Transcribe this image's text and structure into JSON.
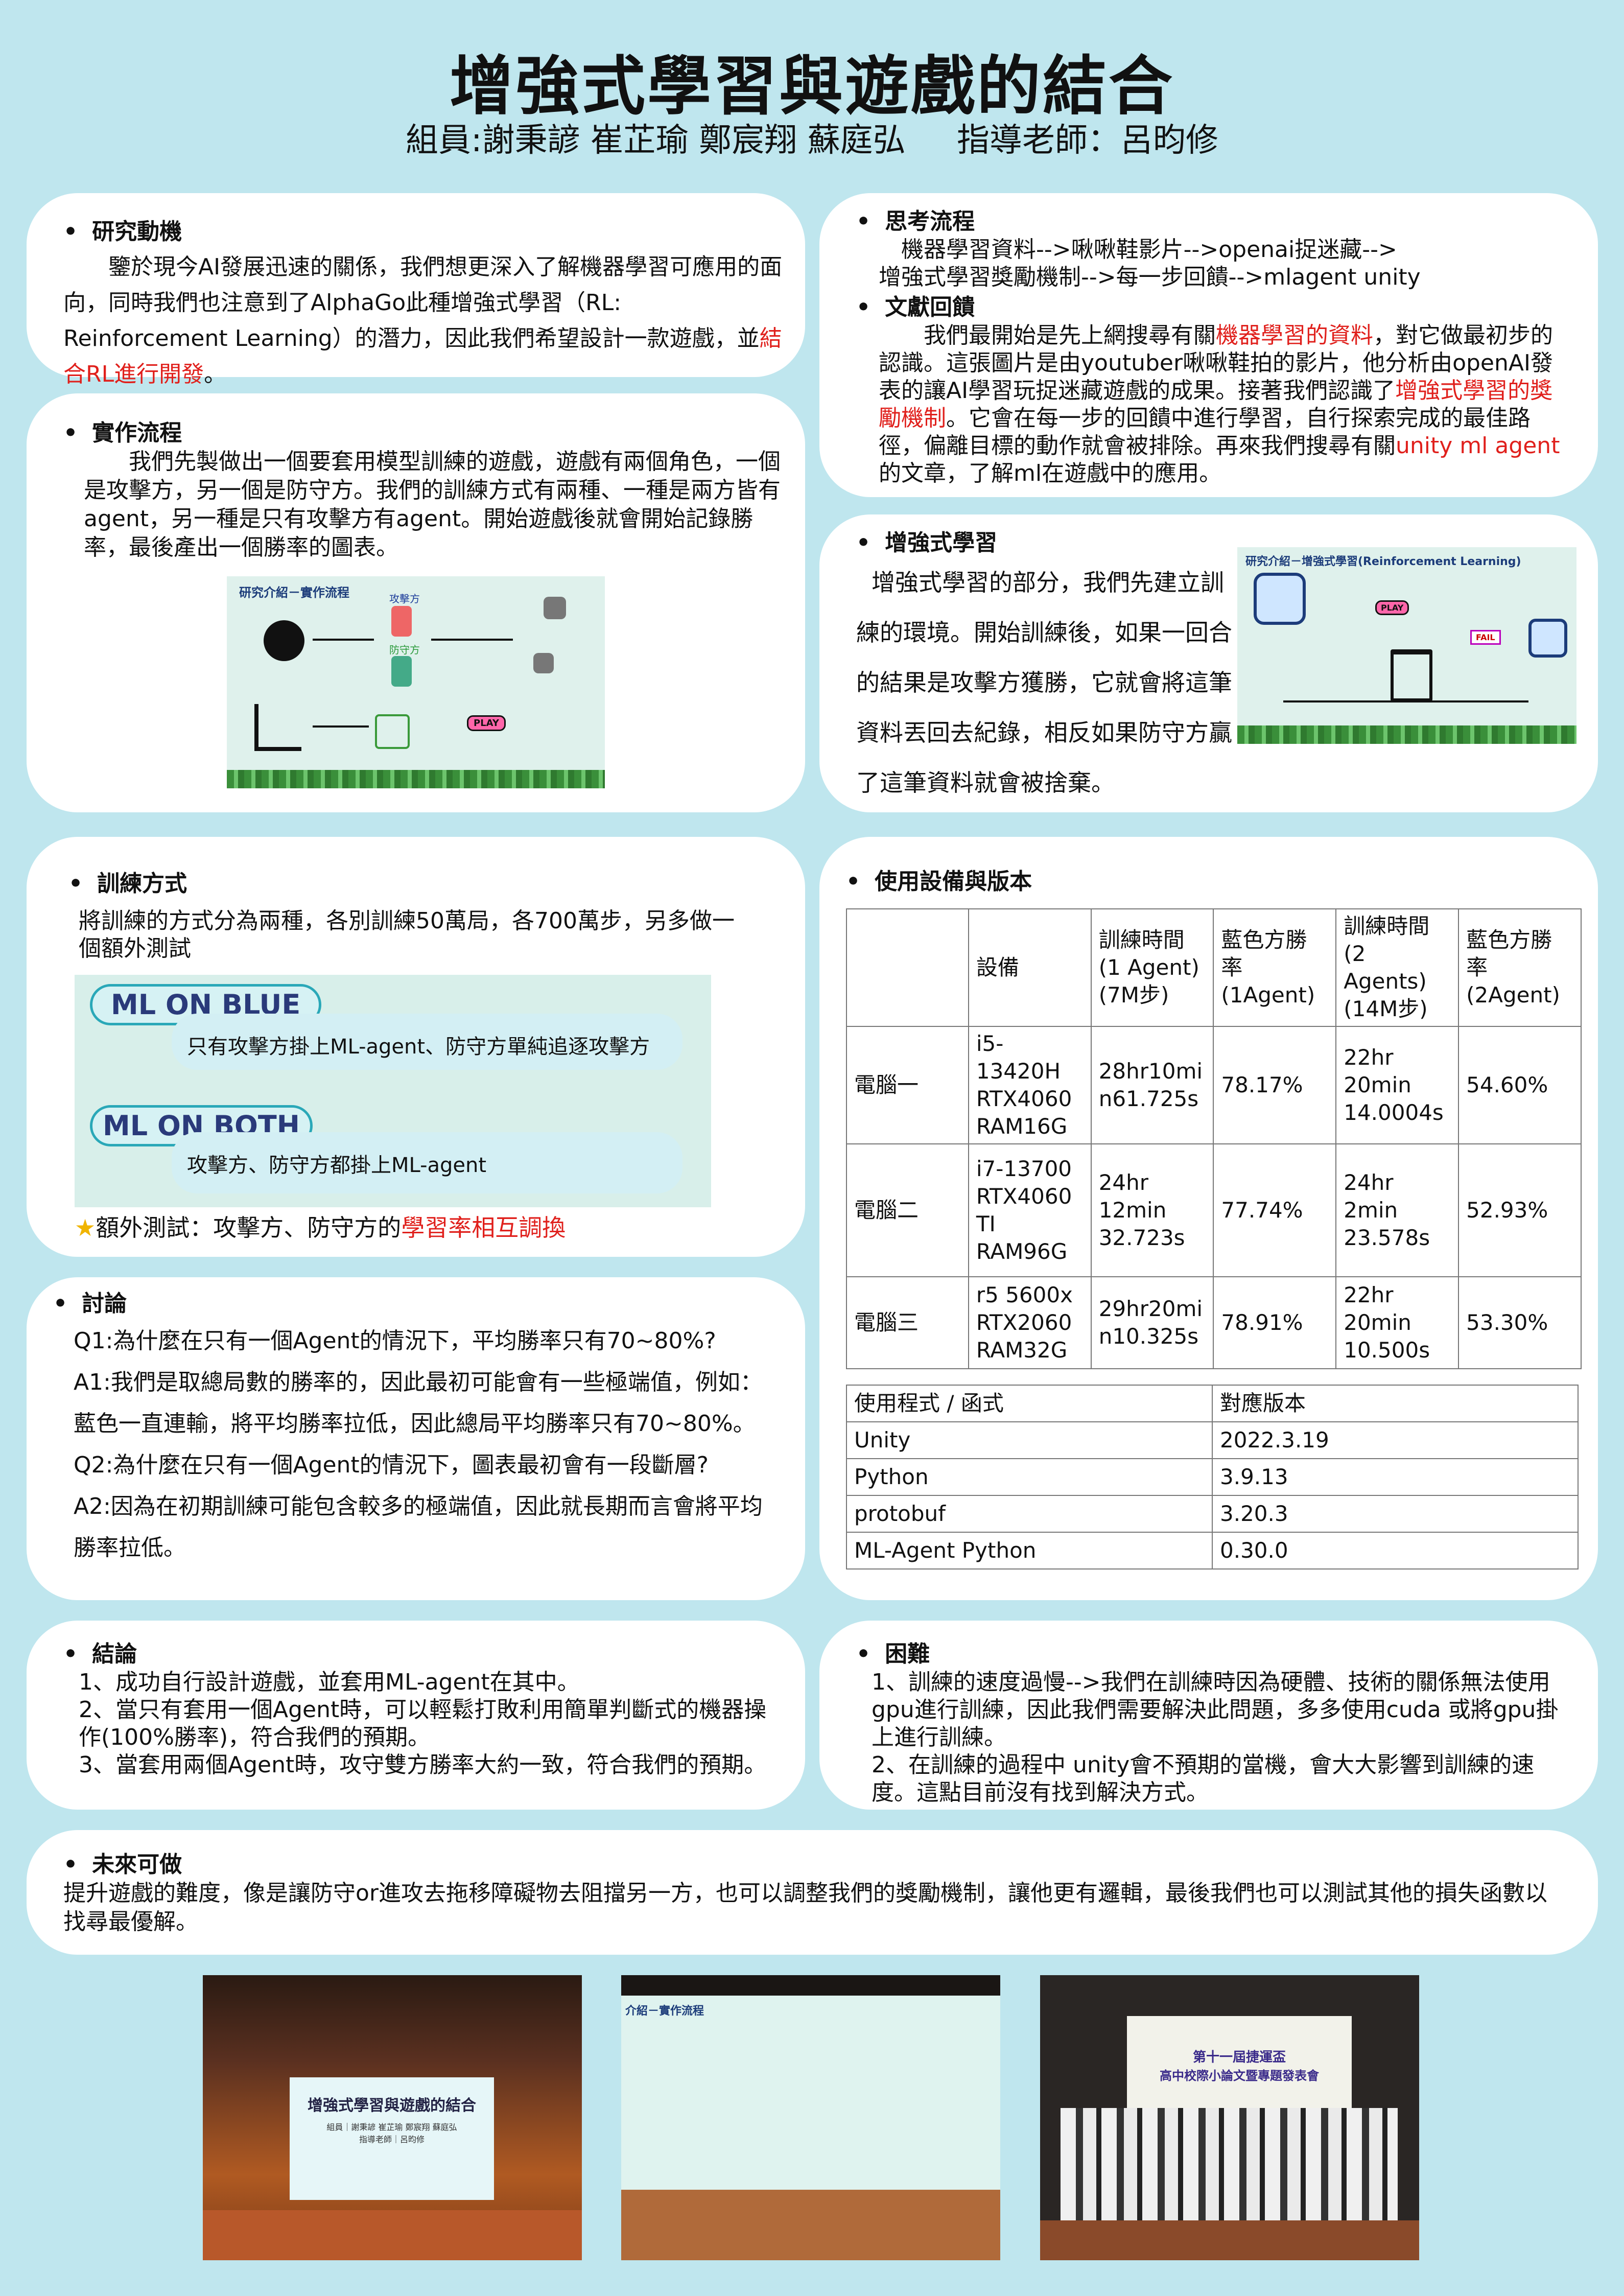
{
  "header": {
    "title": "增強式學習與遊戲的結合",
    "members": "組員:謝秉諺 崔芷瑜 鄭宸翔 蘇庭弘",
    "advisor": "指導老師：呂昀修"
  },
  "motivation": {
    "heading": "研究動機",
    "text": "鑒於現今AI發展迅速的關係，我們想更深入了解機器學習可應用的面向，同時我們也注意到了AlphaGo此種增強式學習（RL: Reinforcement Learning）的潛力，因此我們希望設計一款遊戲，並",
    "highlight": "結合RL進行開發",
    "end": "。"
  },
  "implementation": {
    "heading": "實作流程",
    "text": "我們先製做出一個要套用模型訓練的遊戲，遊戲有兩個角色，一個是攻擊方，另一個是防守方。我們的訓練方式有兩種、一種是兩方皆有agent，另一種是只有攻擊方有agent。開始遊戲後就會開始記錄勝率，最後產出一個勝率的圖表。",
    "figure_title": "研究介紹－實作流程",
    "attacker_label": "攻擊方",
    "defender_label": "防守方",
    "play_label": "PLAY"
  },
  "thinking": {
    "heading": "思考流程",
    "line1": "機器學習資料-->啾啾鞋影片-->openai捉迷藏-->",
    "line2": "增強式學習獎勵機制-->每一步回饋-->mlagent unity"
  },
  "literature": {
    "heading": "文獻回饋",
    "t1": "我們最開始是先上網搜尋有關",
    "r1": "機器學習的資料",
    "t2": "，對它做最初步的認識。這張圖片是由youtuber啾啾鞋拍的影片，他分析由openAI發表的讓AI學習玩捉迷藏遊戲的成果。接著我們認識了",
    "r2": "增強式學習的獎勵機制",
    "t3": "。它會在每一步的回饋中進行學習，自行探索完成的最佳路徑，偏離目標的動作就會被排除。再來我們搜尋有關",
    "r3": "unity ml agent",
    "t4": "的文章，了解ml在遊戲中的應用。"
  },
  "rl": {
    "heading": "增強式學習",
    "text": "增強式學習的部分，我們先建立訓練的環境。開始訓練後，如果一回合的結果是攻擊方獲勝，它就會將這筆資料丟回去紀錄，相反如果防守方贏了這筆資料就會被捨棄。",
    "figure_title": "研究介紹－增強式學習(Reinforcement Learning)",
    "play_label": "PLAY",
    "fail_label": "FAIL"
  },
  "training": {
    "heading": "訓練方式",
    "text": "將訓練的方式分為兩種，各別訓練50萬局，各700萬步，另多做一個額外測試",
    "blue_title": "ML ON BLUE",
    "blue_desc": "只有攻擊方掛上ML-agent、防守方單純追逐攻擊方",
    "both_title": "ML ON BOTH",
    "both_desc": "攻擊方、防守方都掛上ML-agent",
    "extra_text": "額外測試：攻擊方、防守方的",
    "extra_highlight": "學習率相互調換"
  },
  "equipment": {
    "heading": "使用設備與版本",
    "headers": [
      "",
      "設備",
      "訓練時間 (1 Agent) (7M步)",
      "藍色方勝率 (1Agent)",
      "訓練時間 (2 Agents) (14M步)",
      "藍色方勝率 (2Agent)"
    ],
    "rows": [
      [
        "電腦一",
        "i5-13420H RTX4060 RAM16G",
        "28hr10min61.725s",
        "78.17%",
        "22hr 20min 14.0004s",
        "54.60%"
      ],
      [
        "電腦二",
        "i7-13700 RTX4060 TI RAM96G",
        "24hr 12min 32.723s",
        "77.74%",
        "24hr 2min 23.578s",
        "52.93%"
      ],
      [
        "電腦三",
        "r5 5600x RTX2060 RAM32G",
        "29hr20min10.325s",
        "78.91%",
        "22hr 20min 10.500s",
        "53.30%"
      ]
    ],
    "version_headers": [
      "使用程式 / 函式",
      "對應版本"
    ],
    "versions": [
      [
        "Unity",
        "2022.3.19"
      ],
      [
        "Python",
        "3.9.13"
      ],
      [
        "protobuf",
        "3.20.3"
      ],
      [
        "ML-Agent Python",
        "0.30.0"
      ]
    ]
  },
  "discussion": {
    "heading": "討論",
    "q1": "Q1:為什麼在只有一個Agent的情況下，平均勝率只有70~80%?",
    "a1": "A1:我們是取總局數的勝率的，因此最初可能會有一些極端值，例如：藍色一直連輸，將平均勝率拉低，因此總局平均勝率只有70~80%。",
    "q2": "Q2:為什麼在只有一個Agent的情況下，圖表最初會有一段斷層?",
    "a2": "A2:因為在初期訓練可能包含較多的極端值，因此就長期而言會將平均勝率拉低。"
  },
  "conclusion": {
    "heading": "結論",
    "items": [
      "1、成功自行設計遊戲，並套用ML-agent在其中。",
      "2、當只有套用一個Agent時，可以輕鬆打敗利用簡單判斷式的機器操作(100%勝率)，符合我們的預期。",
      "3、當套用兩個Agent時，攻守雙方勝率大約一致，符合我們的預期。"
    ]
  },
  "difficulty": {
    "heading": "困難",
    "items": [
      "1、訓練的速度過慢-->我們在訓練時因為硬體、技術的關係無法使用gpu進行訓練，因此我們需要解決此問題，多多使用cuda 或將gpu掛上進行訓練。",
      "2、在訓練的過程中 unity會不預期的當機，會大大影響到訓練的速度。這點目前沒有找到解決方式。"
    ]
  },
  "future": {
    "heading": "未來可做",
    "text": "提升遊戲的難度，像是讓防守or進攻去拖移障礙物去阻擋另一方，也可以調整我們的獎勵機制，讓他更有邏輯，最後我們也可以測試其他的損失函數以找尋最優解。"
  },
  "photos": {
    "p1_title": "增強式學習與遊戲的結合",
    "p1_sub": "組員｜謝秉諺 崔芷瑜 鄭宸翔 蘇庭弘\n指導老師｜呂昀修",
    "p2_title": "介紹－實作流程",
    "p3_line1": "第十一屆捷運盃",
    "p3_line2": "高中校際小論文暨專題發表會"
  },
  "colors": {
    "background": "#bfe6ee",
    "accent_red": "#e0201c",
    "card": "#ffffff"
  }
}
